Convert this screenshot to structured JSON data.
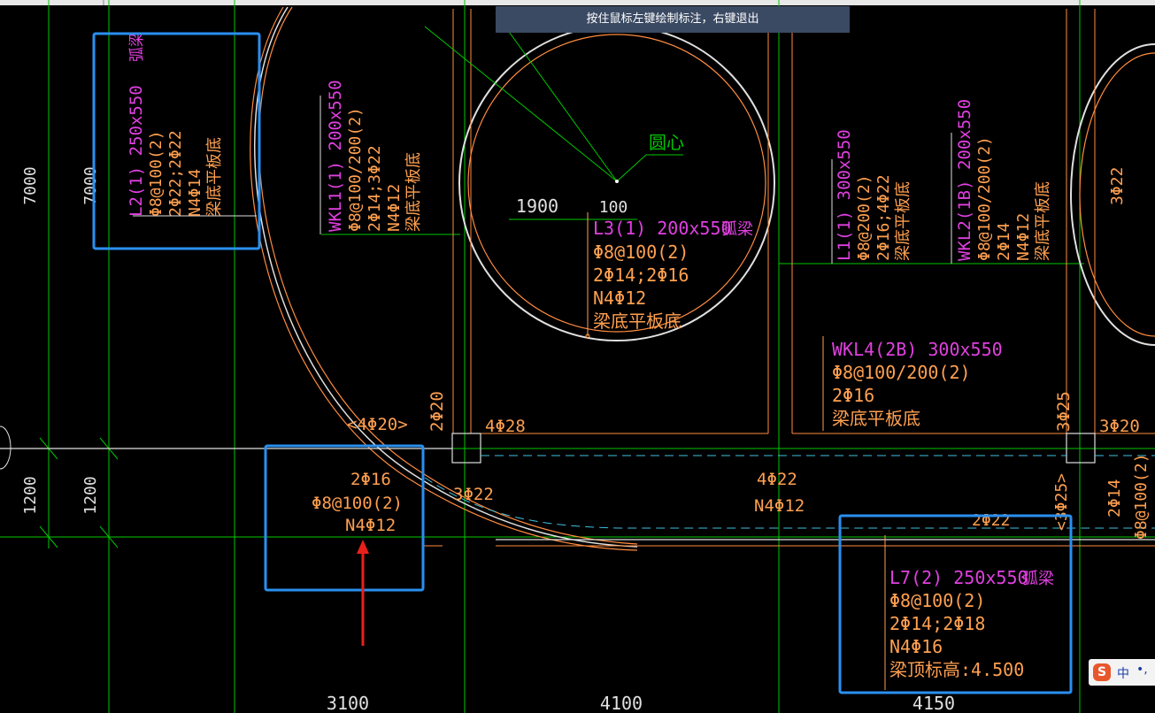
{
  "tooltip": {
    "text": "按住鼠标左键绘制标注，右键退出"
  },
  "ime": {
    "logo": "S",
    "lang": "中",
    "punct": "•,"
  },
  "colors": {
    "grid": "#00c800",
    "beam": "#ff8c40",
    "magenta": "#e040e0",
    "orange_text": "#ffa050",
    "white_line": "#e0e0e0",
    "cyan_dash": "#40c0e0",
    "highlight_box": "#2a8ff0",
    "arrow": "#e8201c"
  },
  "labels": {
    "dim_left_7000_a": "7000",
    "dim_left_7000_b": "7000",
    "dim_left_1200_a": "1200",
    "dim_left_1200_b": "1200",
    "dim_bottom_3100": "3100",
    "dim_bottom_4100": "4100",
    "dim_bottom_4150": "4150",
    "dim_1900": "1900",
    "dim_100": "100",
    "circle_center": "圆心"
  },
  "beam_l2": {
    "name": "L2(1) 250x550",
    "tag": "弧梁",
    "stirrup": "Φ8@100(2)",
    "bars": "2Φ22;2Φ22",
    "side": "N4Φ14",
    "note": "梁底平板底"
  },
  "beam_wkl1": {
    "name": "WKL1(1) 200x550",
    "stirrup": "Φ8@100/200(2)",
    "bars": "2Φ14;3Φ22",
    "side": "N4Φ12",
    "note": "梁底平板底"
  },
  "beam_l3": {
    "name": "L3(1) 200x550",
    "tag": "弧梁",
    "stirrup": "Φ8@100(2)",
    "bars": "2Φ14;2Φ16",
    "side": "N4Φ12",
    "note": "梁底平板底"
  },
  "beam_l1": {
    "name": "L1(1) 300x550",
    "stirrup": "Φ8@200(2)",
    "bars": "2Φ16;4Φ22",
    "note": "梁底平板底"
  },
  "beam_wkl2": {
    "name": "WKL2(1B) 200x550",
    "stirrup": "Φ8@100/200(2)",
    "bars": "2Φ14",
    "side": "N4Φ12",
    "note": "梁底平板底"
  },
  "beam_wkl4": {
    "name": "WKL4(2B) 300x550",
    "stirrup": "Φ8@100/200(2)",
    "bars": "2Φ16",
    "note": "梁底平板底"
  },
  "beam_l7": {
    "name": "L7(2) 250x550",
    "tag": "弧梁",
    "stirrup": "Φ8@100(2)",
    "bars": "2Φ14;2Φ18",
    "side": "N4Φ16",
    "note": "梁顶标高:4.500"
  },
  "annot": {
    "a_4phi20": "<4Φ20>",
    "a_2phi20": "2Φ20",
    "a_4phi28": "4Φ28",
    "a_3phi22_top": "3Φ22",
    "a_3phi25_v": "3Φ25",
    "a_3phi20": "3Φ20",
    "a_2phi16": "2Φ16",
    "a_phi8_100_2": "Φ8@100(2)",
    "a_n4phi12": "N4Φ12",
    "a_3phi22": "3Φ22",
    "a_4phi22": "4Φ22",
    "a_n4phi12_b": "N4Φ12",
    "a_2phi22": "2Φ22",
    "a_3phi25_b": "<3Φ25>",
    "a_2phi14": "2Φ14",
    "a_phi8_100_2_r": "Φ8@100(2)"
  }
}
